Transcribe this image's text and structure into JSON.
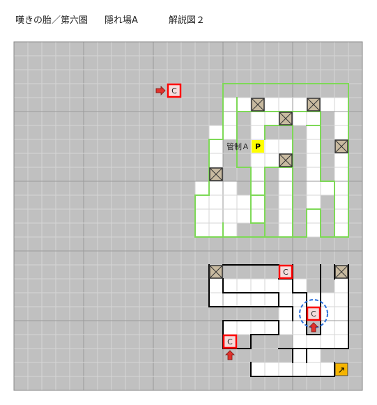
{
  "header": {
    "dungeon": "嘆きの胎／第六圏",
    "area": "隠れ場A",
    "figure": "解説図２"
  },
  "map": {
    "cols": 25,
    "rows": 25,
    "colors": {
      "background": "#c0c0c0",
      "grid_minor": "#d6d6d6",
      "grid_major": "#9a9a9a",
      "floor": "#ffffff",
      "hidden_wall": "#7ed957",
      "wall": "#000000",
      "marker_border": "#ff0000",
      "marker_fill": "#f4dcdc",
      "arrow": "#e0322c",
      "crate_fill": "#c8baa0",
      "pit_fill": "#ffff00",
      "stairs_fill": "#f5b400",
      "circle": "#2a6fdb"
    },
    "control_label": "管制Ａ",
    "pit_label": "P",
    "chest_label": "C",
    "stairs_symbol": "↗",
    "markers": [
      {
        "name": "chest-marker-top",
        "cell": [
          11,
          3
        ],
        "arrow": "right"
      },
      {
        "name": "chest-marker-mid",
        "cell": [
          19,
          16
        ],
        "arrow": null
      },
      {
        "name": "chest-marker-circled",
        "cell": [
          21,
          19
        ],
        "arrow": "up",
        "circled": true
      },
      {
        "name": "chest-marker-bottom",
        "cell": [
          15,
          21
        ],
        "arrow": "up"
      }
    ],
    "crates": [
      [
        17,
        4
      ],
      [
        21,
        4
      ],
      [
        19,
        5
      ],
      [
        23,
        7
      ],
      [
        19,
        8
      ],
      [
        14,
        9
      ],
      [
        14,
        16
      ],
      [
        23,
        16
      ]
    ],
    "pit": [
      17,
      7
    ],
    "stairs": [
      23,
      23
    ]
  }
}
